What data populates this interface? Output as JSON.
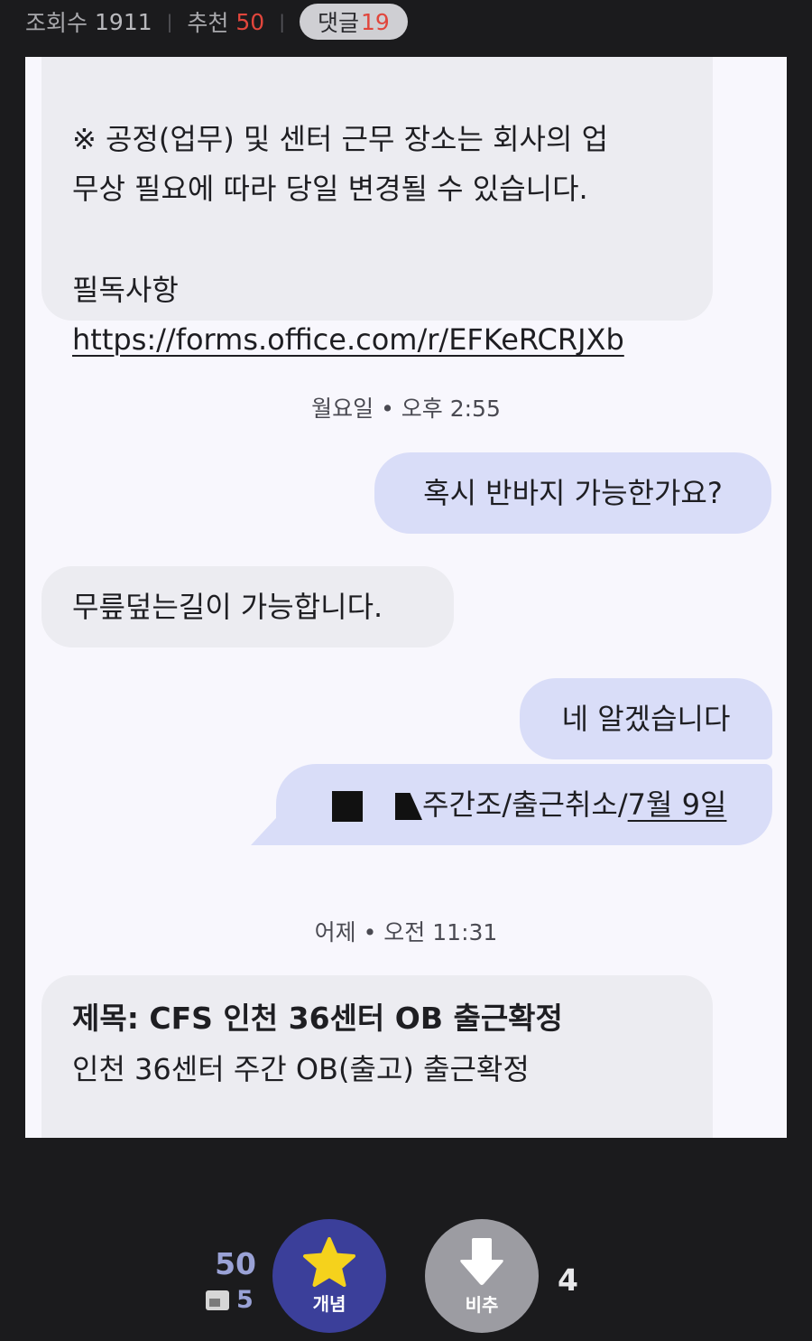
{
  "stats": {
    "views_label": "조회수",
    "views": "1911",
    "recommend_label": "추천",
    "recommend": "50",
    "comments_label": "댓글",
    "comments": "19"
  },
  "chat": {
    "notice_lines": [
      "※ 공정(업무) 및 센터 근무 장소는 회사의 업",
      "무상 필요에 따라 당일 변경될 수 있습니다."
    ],
    "required_label": "필독사항",
    "required_link": "https://forms.office.com/r/EFKeRCRJXb",
    "timestamp1": "월요일 • 오후 2:55",
    "msg_question": "혹시 반바지 가능한가요?",
    "msg_answer": "무릎덮는길이 가능합니다.",
    "msg_ok": "네 알겠습니다",
    "msg_shift_text": "주간조/출근취소/",
    "msg_shift_date": "7월 9일",
    "timestamp2": "어제 • 오전 11:31",
    "confirm_subject": "제목: CFS 인천 36센터 OB 출근확정",
    "confirm_body": "인천 36센터 주간 OB(출고) 출근확정"
  },
  "votes": {
    "up_count": "50",
    "sub_count": "5",
    "up_label": "개념",
    "down_label": "비추",
    "down_count": "4",
    "colors": {
      "up_button": "#3b3f9a",
      "down_button": "#9c9ca2",
      "star": "#f5d21c",
      "accent_red": "#e1463c"
    },
    "icons": [
      "star-icon",
      "down-arrow-icon"
    ]
  }
}
